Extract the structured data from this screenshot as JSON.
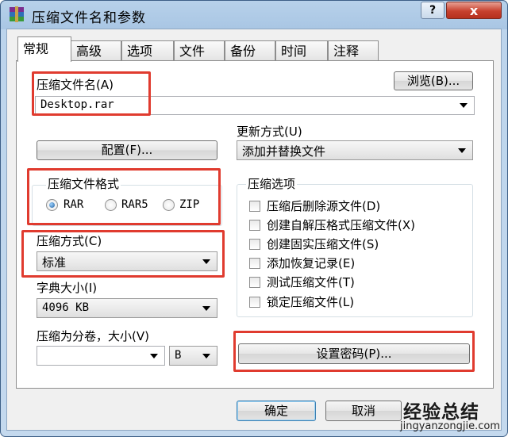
{
  "window": {
    "title": "压缩文件名和参数",
    "help_label": "?",
    "close_label": "x"
  },
  "tabs": [
    "常规",
    "高级",
    "选项",
    "文件",
    "备份",
    "时间",
    "注释"
  ],
  "general": {
    "archive_name_label": "压缩文件名(A)",
    "archive_name_value": "Desktop.rar",
    "browse_label": "浏览(B)...",
    "update_mode_label": "更新方式(U)",
    "update_mode_value": "添加并替换文件",
    "profiles_label": "配置(F)...",
    "format_group_label": "压缩文件格式",
    "formats": [
      "RAR",
      "RAR5",
      "ZIP"
    ],
    "selected_format": "RAR",
    "method_label": "压缩方式(C)",
    "method_value": "标准",
    "dict_label": "字典大小(I)",
    "dict_value": "4096 KB",
    "split_label": "压缩为分卷，大小(V)",
    "split_value": "",
    "split_unit": "B",
    "options_group_label": "压缩选项",
    "options": [
      "压缩后删除源文件(D)",
      "创建自解压格式压缩文件(X)",
      "创建固实压缩文件(S)",
      "添加恢复记录(E)",
      "测试压缩文件(T)",
      "锁定压缩文件(L)"
    ],
    "password_label": "设置密码(P)..."
  },
  "footer": {
    "ok_label": "确定",
    "cancel_label": "取消"
  },
  "watermark": {
    "main": "经验总结",
    "sub": "jingyanzongjie.com"
  },
  "colors": {
    "highlight": "#e03b2f",
    "title_bar": "#b7d1ea",
    "close_button": "#c7412e"
  }
}
